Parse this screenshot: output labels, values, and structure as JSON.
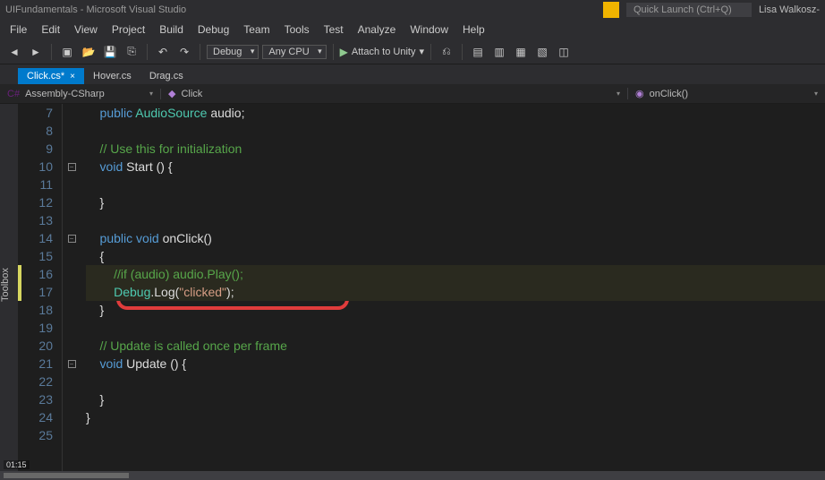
{
  "window": {
    "title": "UIFundamentals - Microsoft Visual Studio",
    "quick_launch_placeholder": "Quick Launch (Ctrl+Q)",
    "user": "Lisa Walkosz-"
  },
  "menu": [
    "File",
    "Edit",
    "View",
    "Project",
    "Build",
    "Debug",
    "Team",
    "Tools",
    "Test",
    "Analyze",
    "Window",
    "Help"
  ],
  "toolbar": {
    "config": "Debug",
    "platform": "Any CPU",
    "attach": "Attach to Unity"
  },
  "tabs": [
    {
      "label": "Click.cs*",
      "active": true
    },
    {
      "label": "Hover.cs",
      "active": false
    },
    {
      "label": "Drag.cs",
      "active": false
    }
  ],
  "nav": {
    "assembly": "Assembly-CSharp",
    "class": "Click",
    "method": "onClick()"
  },
  "side_tool": "Toolbox",
  "line_start": 7,
  "lines": [
    {
      "n": 7,
      "fold": "",
      "t": [
        {
          "c": "kw",
          "v": "    public "
        },
        {
          "c": "cls",
          "v": "AudioSource "
        },
        {
          "c": "ident",
          "v": "audio"
        },
        {
          "c": "punc",
          "v": ";"
        }
      ]
    },
    {
      "n": 8,
      "fold": "",
      "t": []
    },
    {
      "n": 9,
      "fold": "",
      "t": [
        {
          "c": "cmt",
          "v": "    // Use this for initialization"
        }
      ]
    },
    {
      "n": 10,
      "fold": "-",
      "t": [
        {
          "c": "kw",
          "v": "    void "
        },
        {
          "c": "ident",
          "v": "Start "
        },
        {
          "c": "punc",
          "v": "() {"
        }
      ]
    },
    {
      "n": 11,
      "fold": "",
      "t": []
    },
    {
      "n": 12,
      "fold": "",
      "t": [
        {
          "c": "punc",
          "v": "    }"
        }
      ]
    },
    {
      "n": 13,
      "fold": "",
      "t": []
    },
    {
      "n": 14,
      "fold": "-",
      "t": [
        {
          "c": "kw",
          "v": "    public void "
        },
        {
          "c": "ident",
          "v": "onClick"
        },
        {
          "c": "punc",
          "v": "()"
        }
      ]
    },
    {
      "n": 15,
      "fold": "",
      "t": [
        {
          "c": "punc",
          "v": "    {"
        }
      ]
    },
    {
      "n": 16,
      "fold": "",
      "hl": true,
      "mark": true,
      "t": [
        {
          "c": "cmt",
          "v": "        //if (audio) audio.Play();"
        }
      ]
    },
    {
      "n": 17,
      "fold": "",
      "hl": true,
      "t": [
        {
          "c": "cls",
          "v": "        Debug"
        },
        {
          "c": "punc",
          "v": "."
        },
        {
          "c": "ident",
          "v": "Log"
        },
        {
          "c": "punc",
          "v": "("
        },
        {
          "c": "str",
          "v": "\"clicked\""
        },
        {
          "c": "punc",
          "v": ");"
        }
      ]
    },
    {
      "n": 18,
      "fold": "",
      "t": [
        {
          "c": "punc",
          "v": "    }"
        }
      ]
    },
    {
      "n": 19,
      "fold": "",
      "t": []
    },
    {
      "n": 20,
      "fold": "",
      "t": [
        {
          "c": "cmt",
          "v": "    // Update is called once per frame"
        }
      ]
    },
    {
      "n": 21,
      "fold": "-",
      "t": [
        {
          "c": "kw",
          "v": "    void "
        },
        {
          "c": "ident",
          "v": "Update "
        },
        {
          "c": "punc",
          "v": "() {"
        }
      ]
    },
    {
      "n": 22,
      "fold": "",
      "t": []
    },
    {
      "n": 23,
      "fold": "",
      "t": [
        {
          "c": "punc",
          "v": "    }"
        }
      ]
    },
    {
      "n": 24,
      "fold": "",
      "t": [
        {
          "c": "punc",
          "v": "}"
        }
      ]
    },
    {
      "n": 25,
      "fold": "",
      "t": []
    }
  ],
  "playback_time": "01:15"
}
